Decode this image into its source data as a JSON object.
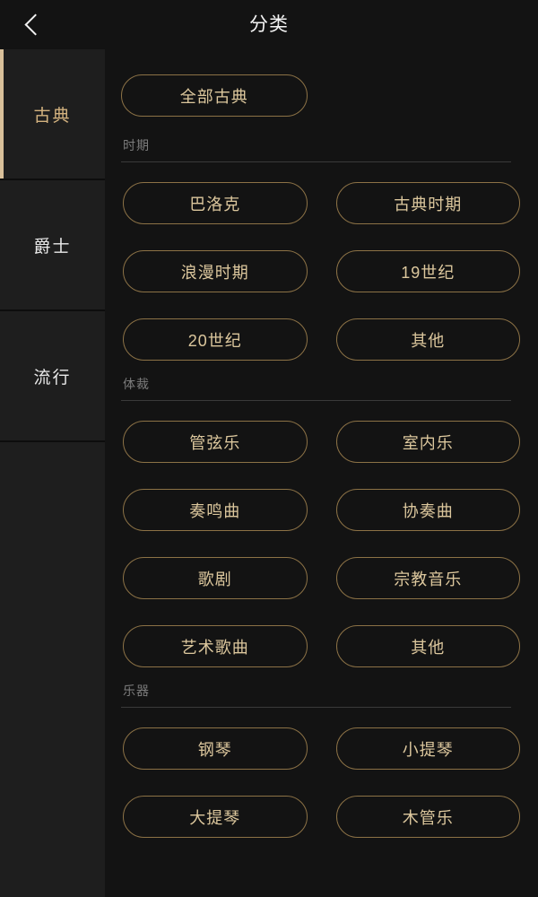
{
  "header": {
    "title": "分类",
    "back_icon": "chevron-left-icon"
  },
  "sidebar": {
    "items": [
      {
        "label": "古典",
        "active": true
      },
      {
        "label": "爵士",
        "active": false
      },
      {
        "label": "流行",
        "active": false
      }
    ]
  },
  "content": {
    "all_chip": {
      "label": "全部古典"
    },
    "sections": [
      {
        "title": "时期",
        "chips": [
          {
            "label": "巴洛克"
          },
          {
            "label": "古典时期"
          },
          {
            "label": "浪漫时期"
          },
          {
            "label": "19世纪"
          },
          {
            "label": "20世纪"
          },
          {
            "label": "其他"
          }
        ]
      },
      {
        "title": "体裁",
        "chips": [
          {
            "label": "管弦乐"
          },
          {
            "label": "室内乐"
          },
          {
            "label": "奏鸣曲"
          },
          {
            "label": "协奏曲"
          },
          {
            "label": "歌剧"
          },
          {
            "label": "宗教音乐"
          },
          {
            "label": "艺术歌曲"
          },
          {
            "label": "其他"
          }
        ]
      },
      {
        "title": "乐器",
        "chips": [
          {
            "label": "钢琴"
          },
          {
            "label": "小提琴"
          },
          {
            "label": "大提琴"
          },
          {
            "label": "木管乐"
          }
        ]
      }
    ]
  },
  "colors": {
    "background": "#131313",
    "sidebar_background": "#1e1e1e",
    "accent_gold": "#d9c09a",
    "chip_border": "#8c7246",
    "chip_text": "#dcc79d",
    "title_text": "#f4f4f4",
    "section_title": "#7c7c7c"
  }
}
